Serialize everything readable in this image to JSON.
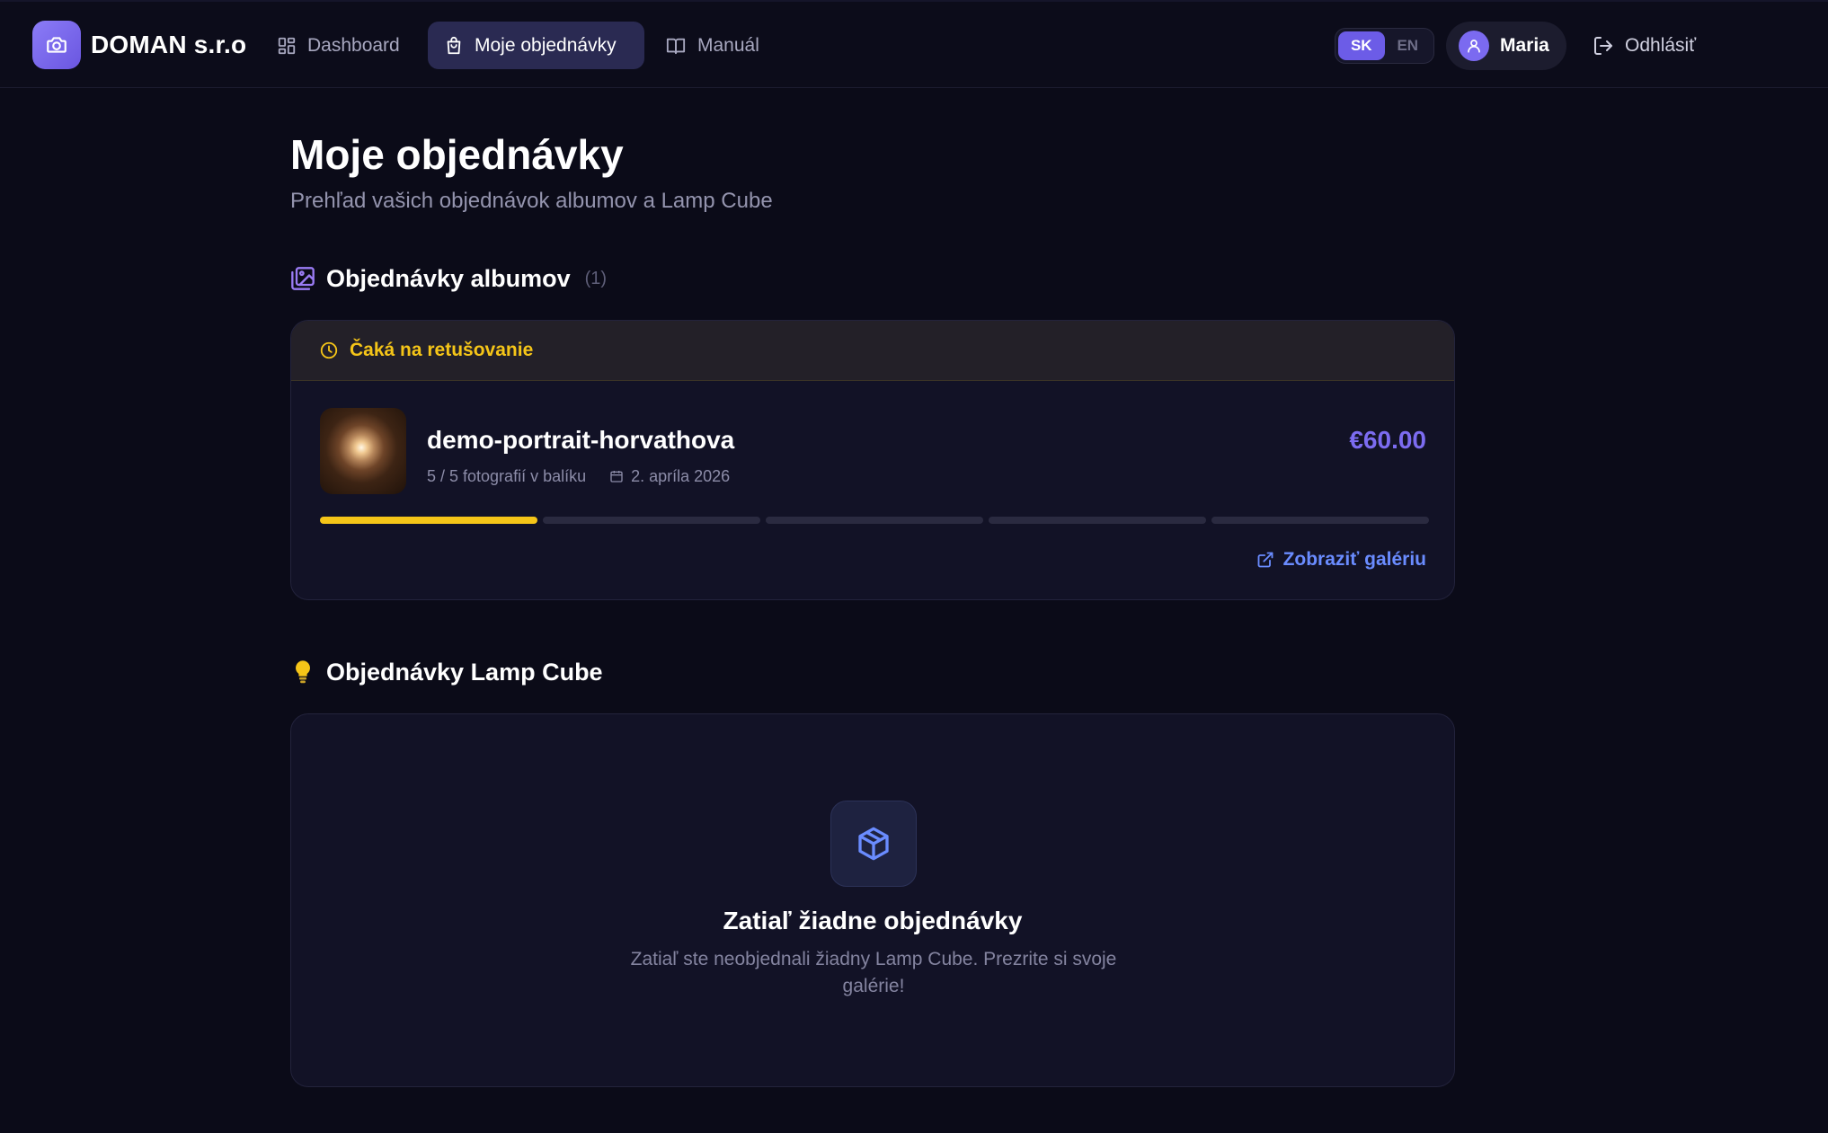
{
  "brand": {
    "name": "DOMAN s.r.o",
    "icon": "camera-icon",
    "accent": "#7b6af0"
  },
  "nav": {
    "items": [
      {
        "label": "Dashboard",
        "icon": "dashboard-icon"
      },
      {
        "label": "Moje objednávky",
        "icon": "shopping-bag-icon",
        "active": true
      },
      {
        "label": "Manuál",
        "icon": "book-icon"
      }
    ]
  },
  "language": {
    "options": [
      "SK",
      "EN"
    ],
    "selected": "SK"
  },
  "user": {
    "name": "Maria",
    "icon": "user-icon"
  },
  "logout": {
    "label": "Odhlásiť",
    "icon": "logout-icon"
  },
  "page": {
    "title": "Moje objednávky",
    "subtitle": "Prehľad vašich objednávok albumov a Lamp Cube"
  },
  "albums_section": {
    "title": "Objednávky albumov",
    "count": "(1)",
    "icon": "images-icon",
    "orders": [
      {
        "status": "Čaká na retušovanie",
        "status_color": "#f5c518",
        "name": "demo-portrait-horvathova",
        "photos": "5 / 5 fotografií v balíku",
        "date": "2. apríla 2026",
        "price": "€60.00",
        "progress_steps_done": 1,
        "progress_steps_total": 5,
        "link_label": "Zobraziť galériu"
      }
    ]
  },
  "lamp_section": {
    "title": "Objednávky Lamp Cube",
    "icon": "lightbulb-icon",
    "empty": {
      "icon": "cube-icon",
      "title": "Zatiaľ žiadne objednávky",
      "text": "Zatiaľ ste neobjednali žiadny Lamp Cube. Prezrite si svoje galérie!"
    }
  }
}
